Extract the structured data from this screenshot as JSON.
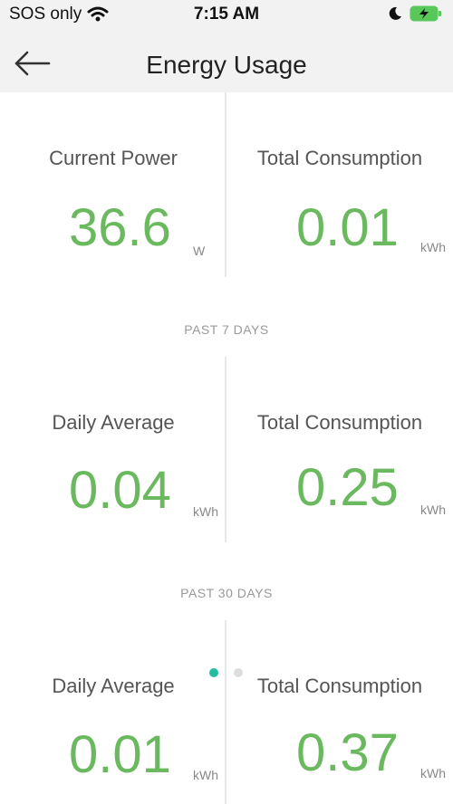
{
  "status_bar": {
    "carrier": "SOS only",
    "time": "7:15 AM"
  },
  "header": {
    "title": "Energy Usage"
  },
  "current": {
    "left": {
      "label": "Current Power",
      "value": "36.6",
      "unit": "W"
    },
    "right": {
      "label": "Total Consumption",
      "value": "0.01",
      "unit": "kWh"
    }
  },
  "past7": {
    "heading": "PAST 7 DAYS",
    "left": {
      "label": "Daily Average",
      "value": "0.04",
      "unit": "kWh"
    },
    "right": {
      "label": "Total Consumption",
      "value": "0.25",
      "unit": "kWh"
    }
  },
  "past30": {
    "heading": "PAST 30 DAYS",
    "left": {
      "label": "Daily Average",
      "value": "0.01",
      "unit": "kWh"
    },
    "right": {
      "label": "Total Consumption",
      "value": "0.37",
      "unit": "kWh"
    }
  },
  "page_indicator": {
    "active": 0,
    "count": 2
  },
  "colors": {
    "value_green": "#6ab95e",
    "dot_active": "#1fbf9f",
    "dot_inactive": "#dddddd",
    "battery_green": "#58c85a"
  }
}
